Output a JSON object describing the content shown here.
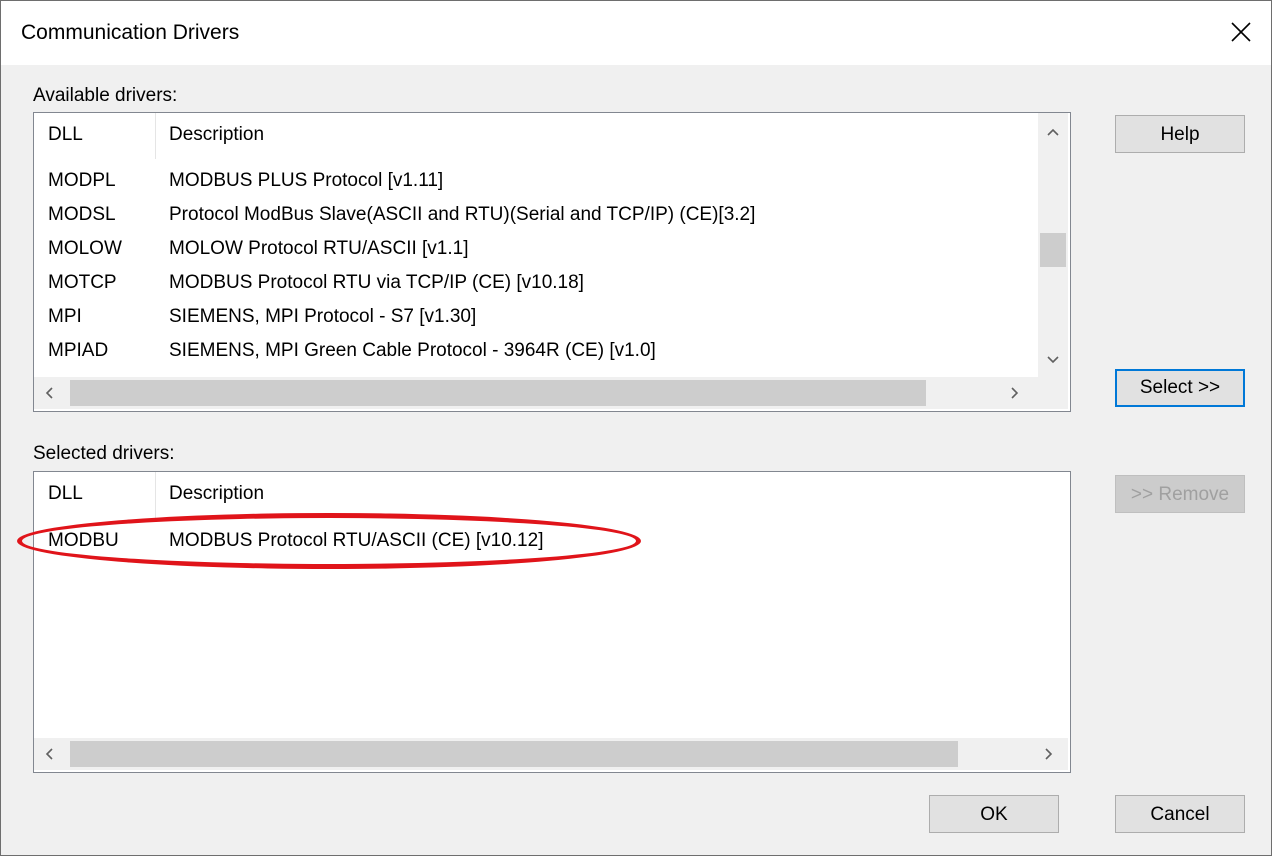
{
  "window": {
    "title": "Communication Drivers",
    "close_icon": "close-icon"
  },
  "available": {
    "label": "Available drivers:",
    "columns": [
      "DLL",
      "Description"
    ],
    "rows": [
      {
        "dll": "MODPL",
        "desc": "MODBUS PLUS Protocol  [v1.11]"
      },
      {
        "dll": "MODSL",
        "desc": "Protocol ModBus Slave(ASCII and RTU)(Serial and TCP/IP) (CE)[3.2]"
      },
      {
        "dll": "MOLOW",
        "desc": "MOLOW Protocol RTU/ASCII [v1.1]"
      },
      {
        "dll": "MOTCP",
        "desc": "MODBUS Protocol RTU via TCP/IP (CE) [v10.18]"
      },
      {
        "dll": "MPI",
        "desc": "SIEMENS, MPI Protocol - S7 [v1.30]"
      },
      {
        "dll": "MPIAD",
        "desc": "SIEMENS, MPI Green Cable Protocol - 3964R (CE) [v1.0]"
      }
    ]
  },
  "selected": {
    "label": "Selected drivers:",
    "columns": [
      "DLL",
      "Description"
    ],
    "rows": [
      {
        "dll": "MODBU",
        "desc": "MODBUS Protocol RTU/ASCII (CE) [v10.12]"
      }
    ]
  },
  "buttons": {
    "help": "Help",
    "select": "Select >>",
    "remove": ">> Remove",
    "ok": "OK",
    "cancel": "Cancel"
  },
  "colors": {
    "highlight": "#e0141a",
    "focus": "#0078d7"
  }
}
